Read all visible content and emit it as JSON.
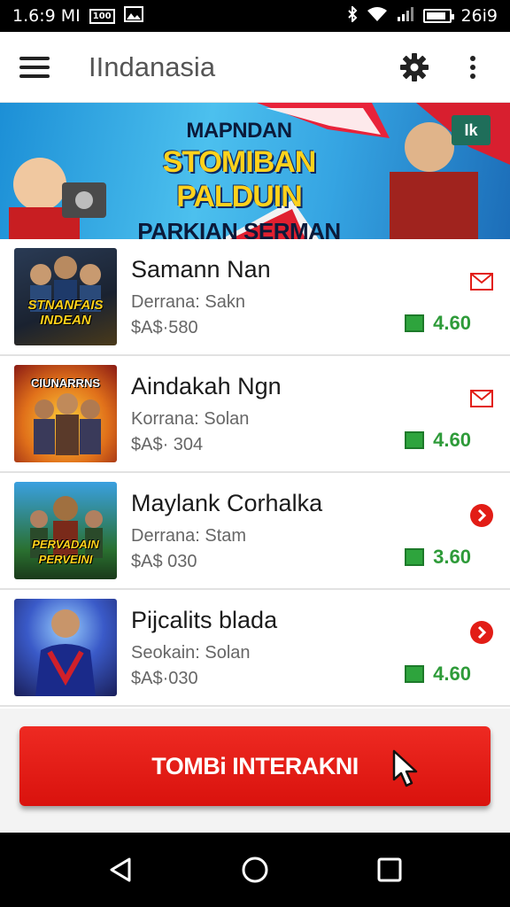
{
  "status_bar": {
    "time": "1.6:9 MI",
    "badge_text": "100",
    "right_time": "26i9",
    "icons": [
      "image-icon",
      "bluetooth-icon",
      "wifi-icon",
      "signal-icon",
      "battery-icon"
    ],
    "battery_level": 0.85
  },
  "app_bar": {
    "title": "IIndanasia",
    "icons": [
      "menu-icon",
      "gear-icon",
      "more-vert-icon"
    ]
  },
  "banner": {
    "line1": "MAPNDAN",
    "line2": "STOMIBAN PALDUIN",
    "line3": "PARKIAN SERMAN",
    "badge": "Ik"
  },
  "games": [
    {
      "title": "Samann Nan",
      "subtitle": "Derrana: Sakn",
      "price": "$A$·580",
      "rating": "4.60",
      "thumb_text": "STNANFAIS INDEAN",
      "action_icon": "mail-icon",
      "thumb_colors": [
        "#1d2a3a",
        "#3b4f2a"
      ]
    },
    {
      "title": "Aindakah Ngn",
      "subtitle": "Korrana: Solan",
      "price": "$A$· 304",
      "rating": "4.60",
      "thumb_text": "CIUNARRNS",
      "action_icon": "mail-icon",
      "thumb_colors": [
        "#f0a020",
        "#a0221a"
      ]
    },
    {
      "title": "Maylank Corhalka",
      "subtitle": "Derrana: Stam",
      "price": "$A$  030",
      "rating": "3.60",
      "thumb_text": "PERVADAIN PERVEINI",
      "action_icon": "chevron-right-circle-icon",
      "thumb_colors": [
        "#2a8fd0",
        "#2a6a28"
      ]
    },
    {
      "title": "Pijcalits blada",
      "subtitle": "Seokain: Solan",
      "price": "$A$·030",
      "rating": "4.60",
      "thumb_text": "",
      "action_icon": "chevron-right-circle-icon",
      "thumb_colors": [
        "#1a2f7a",
        "#d0202a"
      ]
    }
  ],
  "cta": {
    "label": "TOMBi INTERAKNI",
    "icon": "cursor-arrow-icon"
  },
  "nav_bar": {
    "icons": [
      "back-icon",
      "home-icon",
      "recents-icon"
    ]
  },
  "colors": {
    "accent_red": "#e21d16",
    "rating_green": "#2e9b39",
    "banner_blue": "#35a4e2"
  }
}
